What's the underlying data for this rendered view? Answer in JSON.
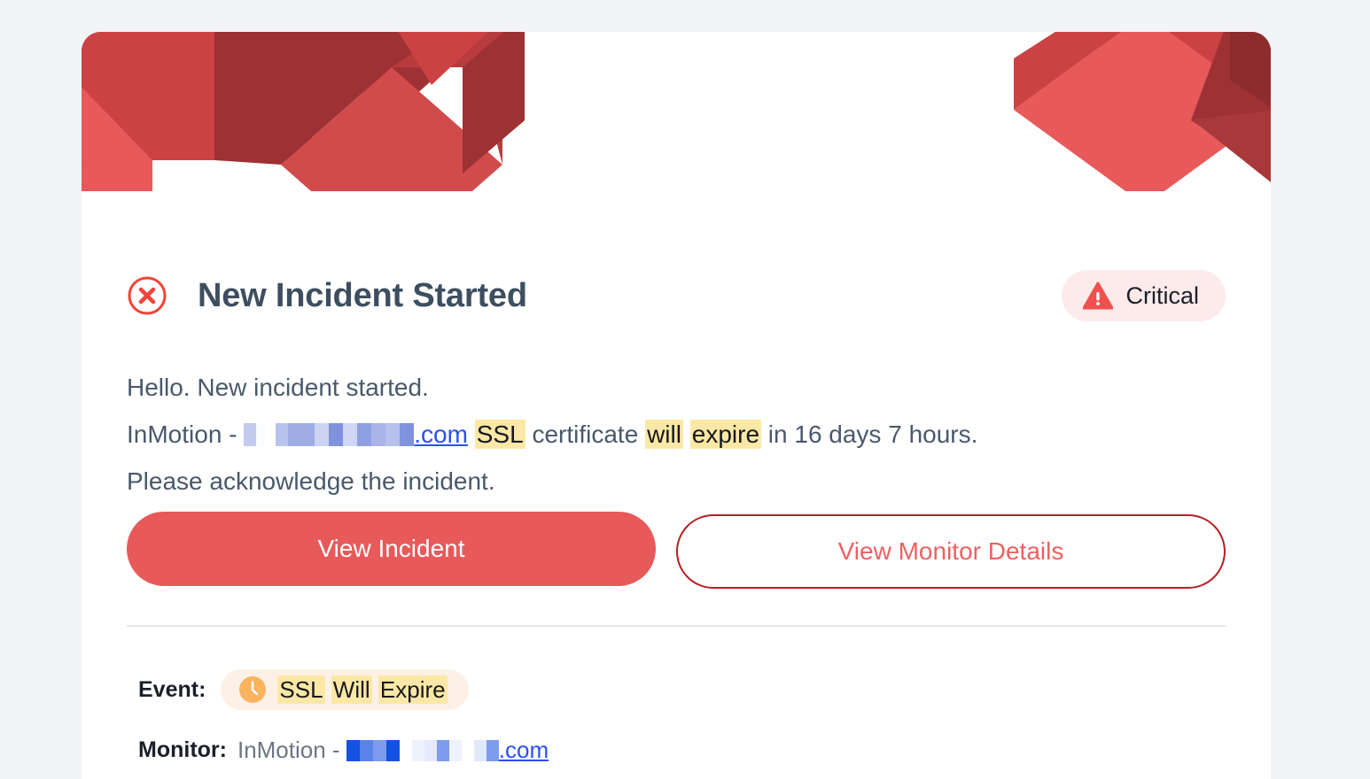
{
  "theme": {
    "page_background": "#f2f4f7",
    "card_background": "#ffffff",
    "accent_red": "#e8595a",
    "accent_red_dark": "#b52025",
    "title_color": "#3d4e5f",
    "body_color": "#49596b",
    "highlight_yellow": "#fce8a6",
    "link_blue": "#2b4ff0",
    "badge_pink": "#fdeaea",
    "pill_peach": "#fdf1e7",
    "divider": "#e5e7ec"
  },
  "header": {
    "art_name": "isometric-cubes-pattern",
    "colors": [
      "#e8595a",
      "#cc4244",
      "#b83c3e",
      "#9e3133",
      "#d14b4c"
    ]
  },
  "incident": {
    "icon": "circle-x-icon",
    "title": "New Incident Started",
    "severity": {
      "icon": "warning-triangle-icon",
      "label": "Critical"
    }
  },
  "body": {
    "line1": "Hello. New incident started.",
    "line2": {
      "prefix": "InMotion - ",
      "redacted_host": "[redacted]",
      "tld": ".com",
      "hl_ssl": "SSL",
      "mid": " certificate ",
      "hl_will": "will",
      "space": " ",
      "hl_expire": "expire",
      "suffix": " in 16 days 7 hours."
    },
    "line3": "Please acknowledge the incident."
  },
  "actions": {
    "primary_label": "View Incident",
    "secondary_label": "View Monitor Details"
  },
  "meta": {
    "event": {
      "label": "Event:",
      "icon": "clock-icon",
      "hl_ssl": "SSL",
      "hl_will": "Will",
      "hl_expire": "Expire"
    },
    "monitor": {
      "label": "Monitor:",
      "prefix": "InMotion - ",
      "redacted_host": "[redacted]",
      "tld": ".com"
    }
  },
  "redaction": {
    "body_blocks": [
      {
        "w": 14,
        "h": 14,
        "c": "#c3ccf0",
        "y": 0
      },
      {
        "w": 10,
        "h": 14,
        "c": "#fbfcfe",
        "y": 0
      },
      {
        "w": 12,
        "h": 14,
        "c": "#ffffff",
        "y": 0
      },
      {
        "w": 14,
        "h": 14,
        "c": "#b9c4ec",
        "y": 0
      },
      {
        "w": 30,
        "h": 14,
        "c": "#9fadE4",
        "y": 0
      },
      {
        "w": 16,
        "h": 14,
        "c": "#ccd4f2",
        "y": 0
      },
      {
        "w": 16,
        "h": 14,
        "c": "#7f92de",
        "y": 0
      },
      {
        "w": 16,
        "h": 14,
        "c": "#cfd7f4",
        "y": 0
      },
      {
        "w": 16,
        "h": 14,
        "c": "#8fa0e2",
        "y": 0
      },
      {
        "w": 16,
        "h": 14,
        "c": "#a9b5e8",
        "y": 0
      },
      {
        "w": 16,
        "h": 14,
        "c": "#b7c1ec",
        "y": 0
      },
      {
        "w": 16,
        "h": 14,
        "c": "#7f92de",
        "y": 0
      }
    ],
    "monitor_blocks": [
      {
        "w": 15,
        "h": 13,
        "c": "#1452e0"
      },
      {
        "w": 15,
        "h": 13,
        "c": "#5c83ea"
      },
      {
        "w": 15,
        "h": 13,
        "c": "#7e9bef"
      },
      {
        "w": 15,
        "h": 13,
        "c": "#1452e0"
      },
      {
        "w": 14,
        "h": 13,
        "c": "#ffffff"
      },
      {
        "w": 14,
        "h": 13,
        "c": "#eef2fd"
      },
      {
        "w": 14,
        "h": 13,
        "c": "#e4eafb"
      },
      {
        "w": 14,
        "h": 13,
        "c": "#7e9bef"
      },
      {
        "w": 14,
        "h": 13,
        "c": "#eef2fd"
      },
      {
        "w": 14,
        "h": 13,
        "c": "#ffffff"
      },
      {
        "w": 14,
        "h": 13,
        "c": "#e0e8fa"
      },
      {
        "w": 14,
        "h": 13,
        "c": "#7e9bef"
      }
    ]
  }
}
